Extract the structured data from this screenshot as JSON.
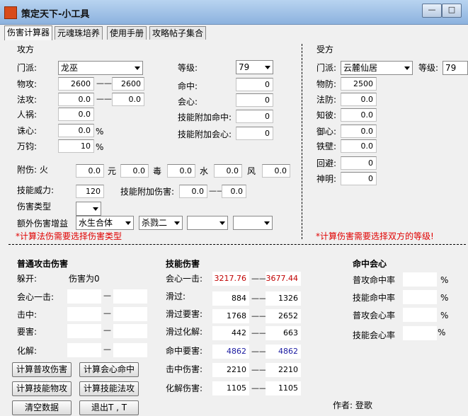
{
  "window": {
    "title": "策定天下-小工具",
    "minimize": "—",
    "maximize": "□"
  },
  "tabs": [
    "伤害计算器",
    "元魂珠培养",
    "使用手册",
    "攻略帖子集合"
  ],
  "attack": {
    "section": "攻方",
    "sect_label": "门派:",
    "sect_value": "龙巫",
    "phys_label": "物攻:",
    "phys_min": "2600",
    "phys_max": "2600",
    "mag_label": "法攻:",
    "mag_min": "0.0",
    "mag_max": "0.0",
    "renhuo_label": "人祸:",
    "renhuo_value": "0.0",
    "zhuxin_label": "诛心:",
    "zhuxin_value": "0.0",
    "wanjun_label": "万钧:",
    "wanjun_value": "10",
    "percent": "%",
    "level_label": "等级:",
    "level_value": "79",
    "hit_label": "命中:",
    "hit_value": "0",
    "crit_label": "会心:",
    "crit_value": "0",
    "skill_hit_label": "技能附加命中:",
    "skill_hit_value": "0",
    "skill_crit_label": "技能附加会心:",
    "skill_crit_value": "0",
    "fushang_label": "附伤: 火",
    "fire_value": "0.0",
    "yuan_label": "元",
    "yuan_value": "0.0",
    "du_label": "毒",
    "du_value": "0.0",
    "shui_label": "水",
    "shui_value": "0.0",
    "feng_label": "风",
    "feng_value": "0.0",
    "power_label": "技能威力:",
    "power_value": "120",
    "skill_dmg_label": "技能附加伤害:",
    "skill_dmg_min": "0.0",
    "skill_dmg_max": "0.0",
    "dmg_type_label": "伤害类型",
    "extra_label": "额外伤害增益",
    "extra_sel1": "水生合体",
    "extra_sel2": "杀戮二",
    "extra_sel3": "",
    "extra_sel4": "",
    "warning": "*计算法伤需要选择伤害类型"
  },
  "defend": {
    "section": "受方",
    "sect_label": "门派:",
    "sect_value": "云麓仙居",
    "level_label": "等级:",
    "level_value": "79",
    "phys_def_label": "物防:",
    "phys_def_value": "2500",
    "mag_def_label": "法防:",
    "mag_def_value": "0.0",
    "zhibi_label": "知彼:",
    "zhibi_value": "0.0",
    "yuxin_label": "御心:",
    "yuxin_value": "0.0",
    "tiebi_label": "铁壁:",
    "tiebi_value": "0.0",
    "dodge_label": "回避:",
    "dodge_value": "0",
    "shenming_label": "神明:",
    "shenming_value": "0",
    "warning": "*计算伤害需要选择双方的等级!"
  },
  "normal": {
    "title": "普通攻击伤害",
    "dodge_label": "躲开:",
    "dodge_result": "伤害为0",
    "crit_label": "会心一击:",
    "hit_label": "击中:",
    "vital_label": "要害:",
    "resolve_label": "化解:"
  },
  "skill": {
    "title": "技能伤害",
    "crit_label": "会心一击:",
    "crit_min": "3217.76",
    "crit_max": "3677.44",
    "graze_label": "滑过:",
    "graze_min": "884",
    "graze_max": "1326",
    "graze_vital_label": "滑过要害:",
    "graze_vital_min": "1768",
    "graze_vital_max": "2652",
    "graze_resolve_label": "滑过化解:",
    "graze_resolve_min": "442",
    "graze_resolve_max": "663",
    "hit_vital_label": "命中要害:",
    "hit_vital_min": "4862",
    "hit_vital_max": "4862",
    "hit_dmg_label": "击中伤害:",
    "hit_dmg_min": "2210",
    "hit_dmg_max": "2210",
    "resolve_dmg_label": "化解伤害:",
    "resolve_dmg_min": "1105",
    "resolve_dmg_max": "1105"
  },
  "rates": {
    "title": "命中会心",
    "normal_hit": "普攻命中率",
    "skill_hit": "技能命中率",
    "normal_crit": "普攻会心率",
    "skill_crit": "技能会心率",
    "percent": "%"
  },
  "buttons": {
    "calc_normal": "计算普攻伤害",
    "calc_crit_hit": "计算会心命中",
    "calc_skill_phys": "计算技能物攻",
    "calc_skill_mag": "计算技能法攻",
    "clear": "清空数据",
    "exit": "退出T , T"
  },
  "author": "作者: 登歌",
  "separator": "——"
}
